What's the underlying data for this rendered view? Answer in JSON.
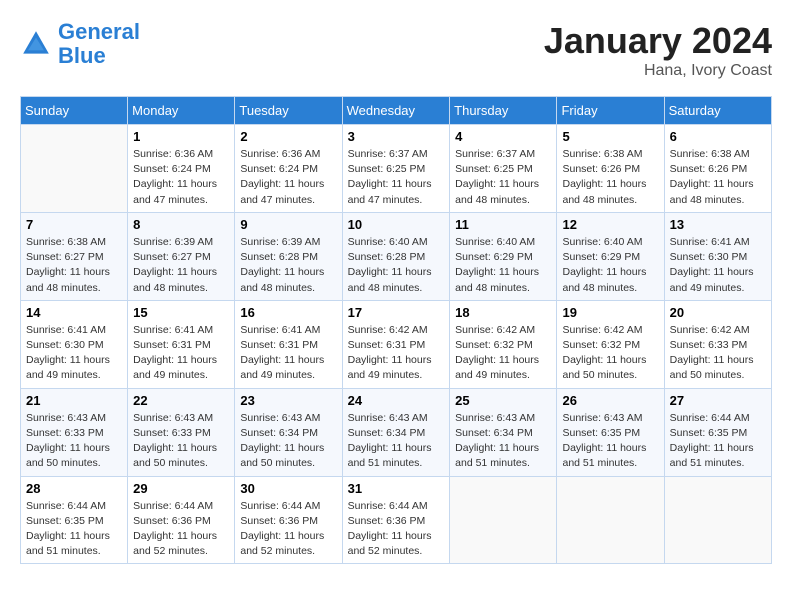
{
  "header": {
    "logo_line1": "General",
    "logo_line2": "Blue",
    "month_year": "January 2024",
    "location": "Hana, Ivory Coast"
  },
  "days_of_week": [
    "Sunday",
    "Monday",
    "Tuesday",
    "Wednesday",
    "Thursday",
    "Friday",
    "Saturday"
  ],
  "weeks": [
    [
      {
        "day": "",
        "sunrise": "",
        "sunset": "",
        "daylight": ""
      },
      {
        "day": "1",
        "sunrise": "Sunrise: 6:36 AM",
        "sunset": "Sunset: 6:24 PM",
        "daylight": "Daylight: 11 hours and 47 minutes."
      },
      {
        "day": "2",
        "sunrise": "Sunrise: 6:36 AM",
        "sunset": "Sunset: 6:24 PM",
        "daylight": "Daylight: 11 hours and 47 minutes."
      },
      {
        "day": "3",
        "sunrise": "Sunrise: 6:37 AM",
        "sunset": "Sunset: 6:25 PM",
        "daylight": "Daylight: 11 hours and 47 minutes."
      },
      {
        "day": "4",
        "sunrise": "Sunrise: 6:37 AM",
        "sunset": "Sunset: 6:25 PM",
        "daylight": "Daylight: 11 hours and 48 minutes."
      },
      {
        "day": "5",
        "sunrise": "Sunrise: 6:38 AM",
        "sunset": "Sunset: 6:26 PM",
        "daylight": "Daylight: 11 hours and 48 minutes."
      },
      {
        "day": "6",
        "sunrise": "Sunrise: 6:38 AM",
        "sunset": "Sunset: 6:26 PM",
        "daylight": "Daylight: 11 hours and 48 minutes."
      }
    ],
    [
      {
        "day": "7",
        "sunrise": "Sunrise: 6:38 AM",
        "sunset": "Sunset: 6:27 PM",
        "daylight": "Daylight: 11 hours and 48 minutes."
      },
      {
        "day": "8",
        "sunrise": "Sunrise: 6:39 AM",
        "sunset": "Sunset: 6:27 PM",
        "daylight": "Daylight: 11 hours and 48 minutes."
      },
      {
        "day": "9",
        "sunrise": "Sunrise: 6:39 AM",
        "sunset": "Sunset: 6:28 PM",
        "daylight": "Daylight: 11 hours and 48 minutes."
      },
      {
        "day": "10",
        "sunrise": "Sunrise: 6:40 AM",
        "sunset": "Sunset: 6:28 PM",
        "daylight": "Daylight: 11 hours and 48 minutes."
      },
      {
        "day": "11",
        "sunrise": "Sunrise: 6:40 AM",
        "sunset": "Sunset: 6:29 PM",
        "daylight": "Daylight: 11 hours and 48 minutes."
      },
      {
        "day": "12",
        "sunrise": "Sunrise: 6:40 AM",
        "sunset": "Sunset: 6:29 PM",
        "daylight": "Daylight: 11 hours and 48 minutes."
      },
      {
        "day": "13",
        "sunrise": "Sunrise: 6:41 AM",
        "sunset": "Sunset: 6:30 PM",
        "daylight": "Daylight: 11 hours and 49 minutes."
      }
    ],
    [
      {
        "day": "14",
        "sunrise": "Sunrise: 6:41 AM",
        "sunset": "Sunset: 6:30 PM",
        "daylight": "Daylight: 11 hours and 49 minutes."
      },
      {
        "day": "15",
        "sunrise": "Sunrise: 6:41 AM",
        "sunset": "Sunset: 6:31 PM",
        "daylight": "Daylight: 11 hours and 49 minutes."
      },
      {
        "day": "16",
        "sunrise": "Sunrise: 6:41 AM",
        "sunset": "Sunset: 6:31 PM",
        "daylight": "Daylight: 11 hours and 49 minutes."
      },
      {
        "day": "17",
        "sunrise": "Sunrise: 6:42 AM",
        "sunset": "Sunset: 6:31 PM",
        "daylight": "Daylight: 11 hours and 49 minutes."
      },
      {
        "day": "18",
        "sunrise": "Sunrise: 6:42 AM",
        "sunset": "Sunset: 6:32 PM",
        "daylight": "Daylight: 11 hours and 49 minutes."
      },
      {
        "day": "19",
        "sunrise": "Sunrise: 6:42 AM",
        "sunset": "Sunset: 6:32 PM",
        "daylight": "Daylight: 11 hours and 50 minutes."
      },
      {
        "day": "20",
        "sunrise": "Sunrise: 6:42 AM",
        "sunset": "Sunset: 6:33 PM",
        "daylight": "Daylight: 11 hours and 50 minutes."
      }
    ],
    [
      {
        "day": "21",
        "sunrise": "Sunrise: 6:43 AM",
        "sunset": "Sunset: 6:33 PM",
        "daylight": "Daylight: 11 hours and 50 minutes."
      },
      {
        "day": "22",
        "sunrise": "Sunrise: 6:43 AM",
        "sunset": "Sunset: 6:33 PM",
        "daylight": "Daylight: 11 hours and 50 minutes."
      },
      {
        "day": "23",
        "sunrise": "Sunrise: 6:43 AM",
        "sunset": "Sunset: 6:34 PM",
        "daylight": "Daylight: 11 hours and 50 minutes."
      },
      {
        "day": "24",
        "sunrise": "Sunrise: 6:43 AM",
        "sunset": "Sunset: 6:34 PM",
        "daylight": "Daylight: 11 hours and 51 minutes."
      },
      {
        "day": "25",
        "sunrise": "Sunrise: 6:43 AM",
        "sunset": "Sunset: 6:34 PM",
        "daylight": "Daylight: 11 hours and 51 minutes."
      },
      {
        "day": "26",
        "sunrise": "Sunrise: 6:43 AM",
        "sunset": "Sunset: 6:35 PM",
        "daylight": "Daylight: 11 hours and 51 minutes."
      },
      {
        "day": "27",
        "sunrise": "Sunrise: 6:44 AM",
        "sunset": "Sunset: 6:35 PM",
        "daylight": "Daylight: 11 hours and 51 minutes."
      }
    ],
    [
      {
        "day": "28",
        "sunrise": "Sunrise: 6:44 AM",
        "sunset": "Sunset: 6:35 PM",
        "daylight": "Daylight: 11 hours and 51 minutes."
      },
      {
        "day": "29",
        "sunrise": "Sunrise: 6:44 AM",
        "sunset": "Sunset: 6:36 PM",
        "daylight": "Daylight: 11 hours and 52 minutes."
      },
      {
        "day": "30",
        "sunrise": "Sunrise: 6:44 AM",
        "sunset": "Sunset: 6:36 PM",
        "daylight": "Daylight: 11 hours and 52 minutes."
      },
      {
        "day": "31",
        "sunrise": "Sunrise: 6:44 AM",
        "sunset": "Sunset: 6:36 PM",
        "daylight": "Daylight: 11 hours and 52 minutes."
      },
      {
        "day": "",
        "sunrise": "",
        "sunset": "",
        "daylight": ""
      },
      {
        "day": "",
        "sunrise": "",
        "sunset": "",
        "daylight": ""
      },
      {
        "day": "",
        "sunrise": "",
        "sunset": "",
        "daylight": ""
      }
    ]
  ]
}
